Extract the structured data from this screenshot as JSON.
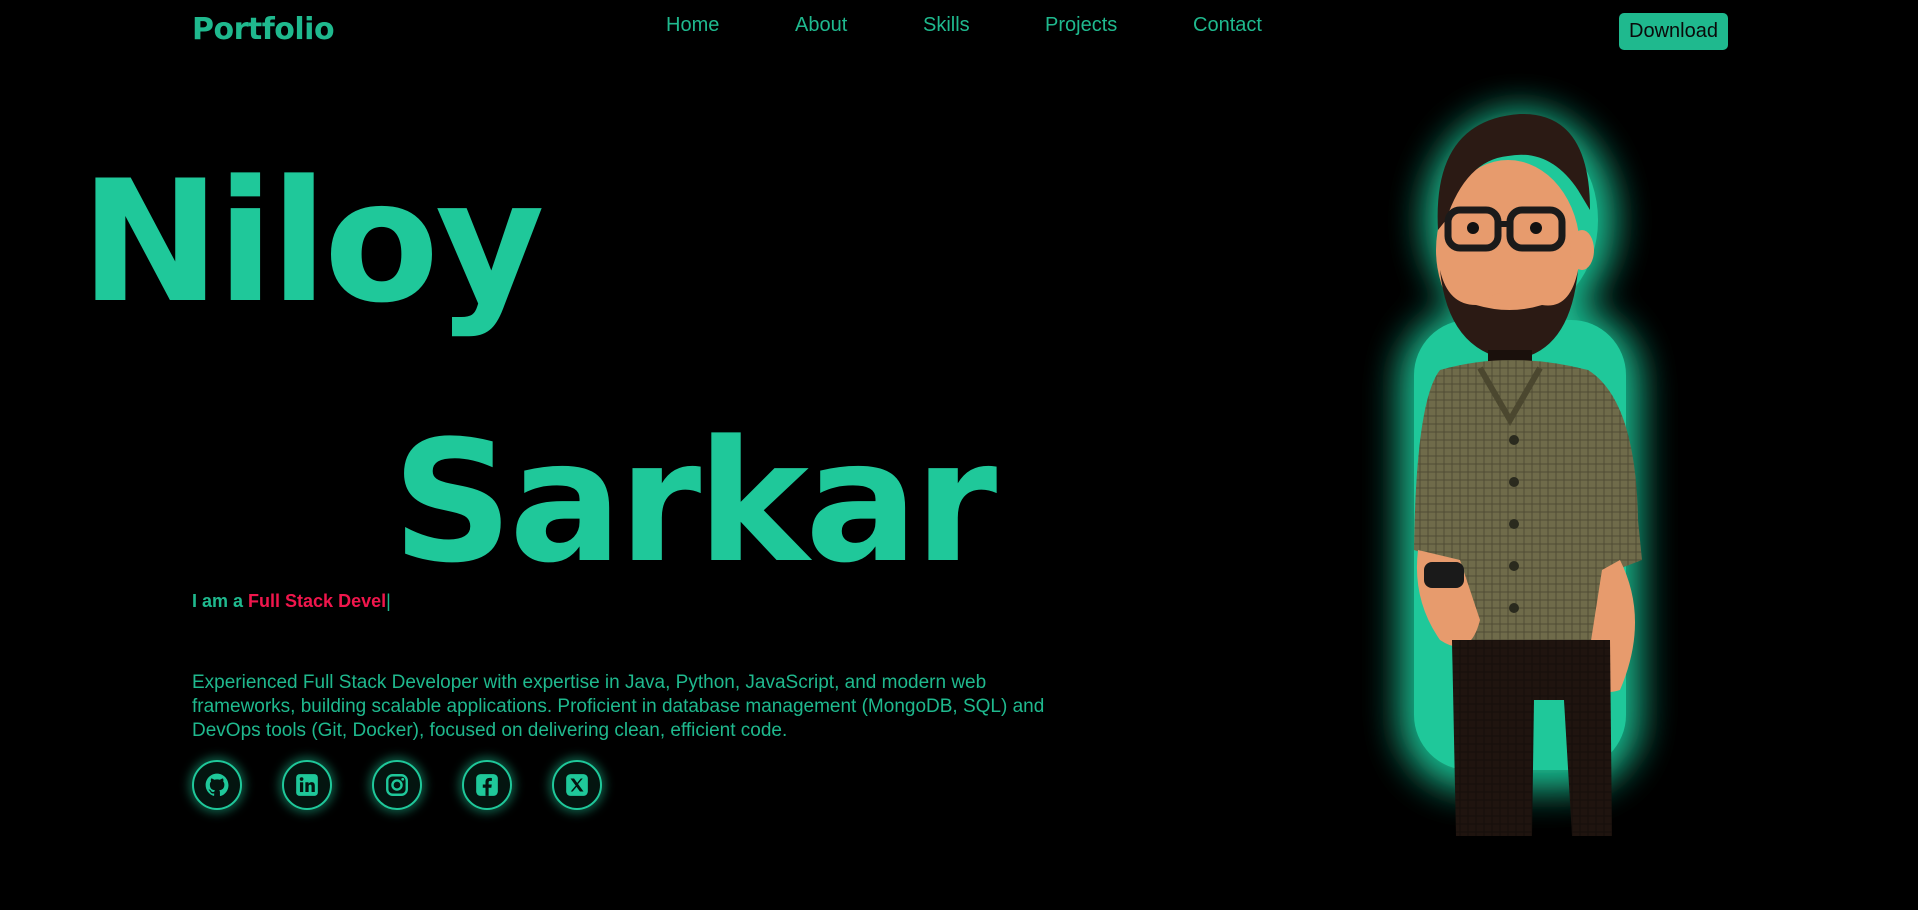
{
  "header": {
    "brand": "Portfolio",
    "nav": [
      "Home",
      "About",
      "Skills",
      "Projects",
      "Contact"
    ],
    "download_label": "Download"
  },
  "hero": {
    "first_name": "Niloy",
    "last_name": "Sarkar",
    "intro_prefix": "I am a",
    "role_typed": "Full Stack Devel",
    "cursor": "|",
    "description": "Experienced Full Stack Developer with expertise in Java, Python, JavaScript, and modern web frameworks, building scalable applications. Proficient in database management (MongoDB, SQL) and DevOps tools (Git, Docker), focused on delivering clean, efficient code."
  },
  "socials": [
    {
      "icon": "github-icon"
    },
    {
      "icon": "linkedin-icon"
    },
    {
      "icon": "instagram-icon"
    },
    {
      "icon": "facebook-icon"
    },
    {
      "icon": "x-icon"
    }
  ],
  "colors": {
    "background": "#000000",
    "accent": "#1fc89a",
    "highlight": "#f0164c"
  }
}
